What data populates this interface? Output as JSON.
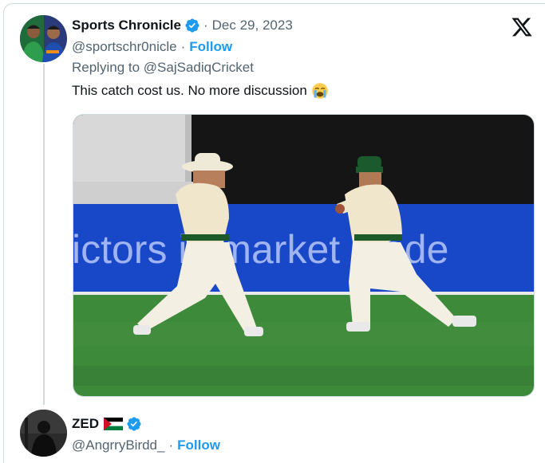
{
  "tweet": {
    "author_name": "Sports Chronicle",
    "separator": "·",
    "date": "Dec 29, 2023",
    "handle": "@sportschr0nicle",
    "follow_label": "Follow",
    "replying_to": "Replying to @SajSadiqCricket",
    "text": "This catch cost us. No more discussion",
    "emoji_icon": "loudly-crying-face-emoji",
    "media": {
      "banner_text": "ictors is market leade",
      "icon": "cricket-fielders-photo"
    }
  },
  "reply": {
    "author_name": "ZED",
    "flag_icon": "palestine-flag-icon",
    "separator": "·",
    "handle": "@AngrryBirdd_",
    "follow_label": "Follow"
  },
  "colors": {
    "accent": "#1d9bf0",
    "text": "#0f1419",
    "muted": "#536471",
    "border": "#cfd9de",
    "banner_blue": "#1847c8",
    "grass": "#3e8a3b"
  }
}
